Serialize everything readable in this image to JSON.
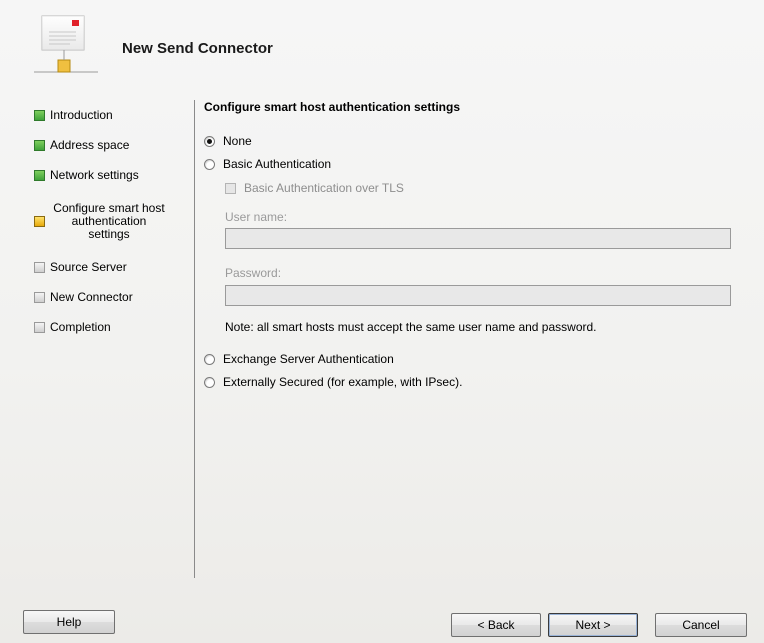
{
  "header": {
    "title": "New Send Connector",
    "icon": "send-connector-icon"
  },
  "nav": {
    "items": [
      {
        "label": "Introduction",
        "state": "done"
      },
      {
        "label": "Address space",
        "state": "done"
      },
      {
        "label": "Network settings",
        "state": "done"
      },
      {
        "label": "Configure smart host authentication settings",
        "state": "current"
      },
      {
        "label": "Source Server",
        "state": "pending"
      },
      {
        "label": "New Connector",
        "state": "pending"
      },
      {
        "label": "Completion",
        "state": "pending"
      }
    ]
  },
  "content": {
    "section_title": "Configure smart host authentication settings",
    "options": {
      "none": {
        "label": "None",
        "checked": true
      },
      "basic": {
        "label": "Basic Authentication",
        "checked": false
      },
      "basic_tls": {
        "label": "Basic Authentication over TLS",
        "checked": false,
        "enabled": false
      },
      "exchange": {
        "label": "Exchange Server Authentication",
        "checked": false
      },
      "external": {
        "label": "Externally Secured (for example, with IPsec).",
        "checked": false
      }
    },
    "username": {
      "label": "User name:",
      "value": ""
    },
    "password": {
      "label": "Password:",
      "value": ""
    },
    "note": "Note: all smart hosts must accept the same user name and password."
  },
  "buttons": {
    "help": "Help",
    "back": "< Back",
    "next": "Next >",
    "cancel": "Cancel"
  },
  "colors": {
    "done": "#3fa33a",
    "current": "#e7a90b",
    "pending": "#cfcfcf"
  }
}
